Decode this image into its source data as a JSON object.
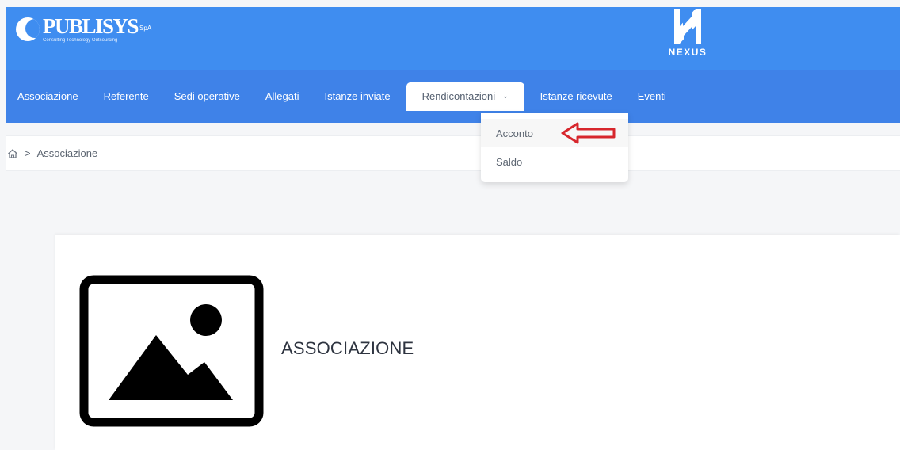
{
  "header": {
    "brand_name": "PUBLISYS",
    "brand_suffix": "SpA",
    "brand_tagline": "Consulting Technology Outsourcing",
    "app_name": "NEXUS",
    "accent_color": "#3f8df0"
  },
  "nav": {
    "items": [
      {
        "label": "Associazione"
      },
      {
        "label": "Referente"
      },
      {
        "label": "Sedi operative"
      },
      {
        "label": "Allegati"
      },
      {
        "label": "Istanze inviate"
      },
      {
        "label": "Rendicontazioni",
        "active": true,
        "caret": "chevron-down-icon"
      },
      {
        "label": "Istanze ricevute"
      },
      {
        "label": "Eventi"
      }
    ],
    "caret_glyph": "⌄"
  },
  "dropdown": {
    "items": [
      {
        "label": "Acconto",
        "annotated": true
      },
      {
        "label": "Saldo"
      }
    ],
    "annotation_color": "#d7262c"
  },
  "breadcrumb": {
    "home_icon": "home-icon",
    "separator": ">",
    "current": "Associazione"
  },
  "content": {
    "image_icon": "image-placeholder-icon",
    "title": "ASSOCIAZIONE"
  }
}
